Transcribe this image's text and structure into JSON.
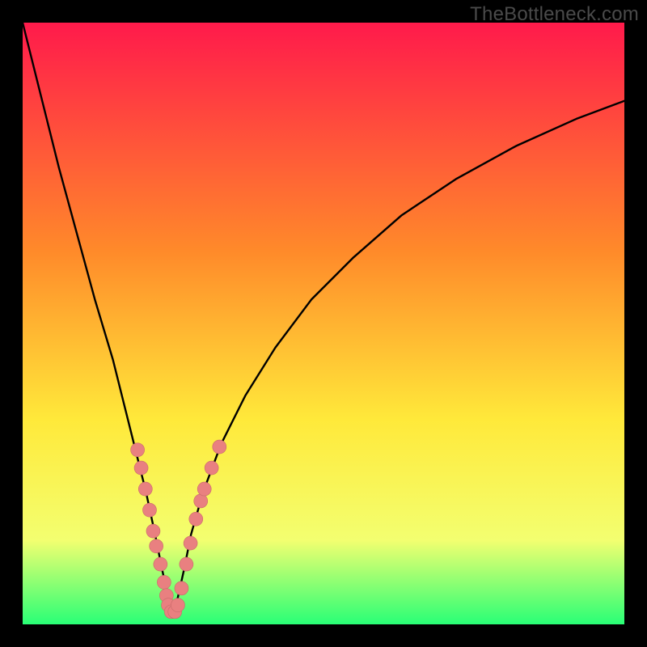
{
  "watermark": "TheBottleneck.com",
  "colors": {
    "frame": "#000000",
    "grad_top": "#ff1a4b",
    "grad_mid1": "#ff8a2a",
    "grad_mid2": "#ffe93a",
    "grad_mid3": "#f3ff70",
    "grad_bot": "#29ff76",
    "curve": "#000000",
    "dot_fill": "#e98080",
    "dot_stroke": "#c96a6a"
  },
  "chart_data": {
    "type": "line",
    "title": "",
    "xlabel": "",
    "ylabel": "",
    "xlim": [
      0,
      100
    ],
    "ylim": [
      0,
      100
    ],
    "series": [
      {
        "name": "bottleneck-curve",
        "x": [
          0,
          3,
          6,
          9,
          12,
          15,
          17,
          19,
          20.5,
          22,
          23.2,
          24.2,
          25,
          25.8,
          26.8,
          28,
          30,
          33,
          37,
          42,
          48,
          55,
          63,
          72,
          82,
          92,
          100
        ],
        "y": [
          100,
          88,
          76,
          65,
          54,
          44,
          36,
          28,
          22,
          15,
          9,
          4.5,
          2,
          4.5,
          9,
          15,
          22,
          30,
          38,
          46,
          54,
          61,
          68,
          74,
          79.5,
          84,
          87
        ]
      }
    ],
    "markers": {
      "name": "highlight-dots",
      "points": [
        {
          "x": 19.1,
          "y": 29.0
        },
        {
          "x": 19.7,
          "y": 26.0
        },
        {
          "x": 20.4,
          "y": 22.5
        },
        {
          "x": 21.1,
          "y": 19.0
        },
        {
          "x": 21.7,
          "y": 15.5
        },
        {
          "x": 22.2,
          "y": 13.0
        },
        {
          "x": 22.9,
          "y": 10.0
        },
        {
          "x": 23.5,
          "y": 7.0
        },
        {
          "x": 23.9,
          "y": 4.8
        },
        {
          "x": 24.2,
          "y": 3.2
        },
        {
          "x": 24.7,
          "y": 2.1
        },
        {
          "x": 25.3,
          "y": 2.1
        },
        {
          "x": 25.8,
          "y": 3.2
        },
        {
          "x": 26.4,
          "y": 6.0
        },
        {
          "x": 27.2,
          "y": 10.0
        },
        {
          "x": 27.9,
          "y": 13.5
        },
        {
          "x": 28.8,
          "y": 17.5
        },
        {
          "x": 29.6,
          "y": 20.5
        },
        {
          "x": 30.2,
          "y": 22.5
        },
        {
          "x": 31.4,
          "y": 26.0
        },
        {
          "x": 32.7,
          "y": 29.5
        }
      ]
    }
  }
}
